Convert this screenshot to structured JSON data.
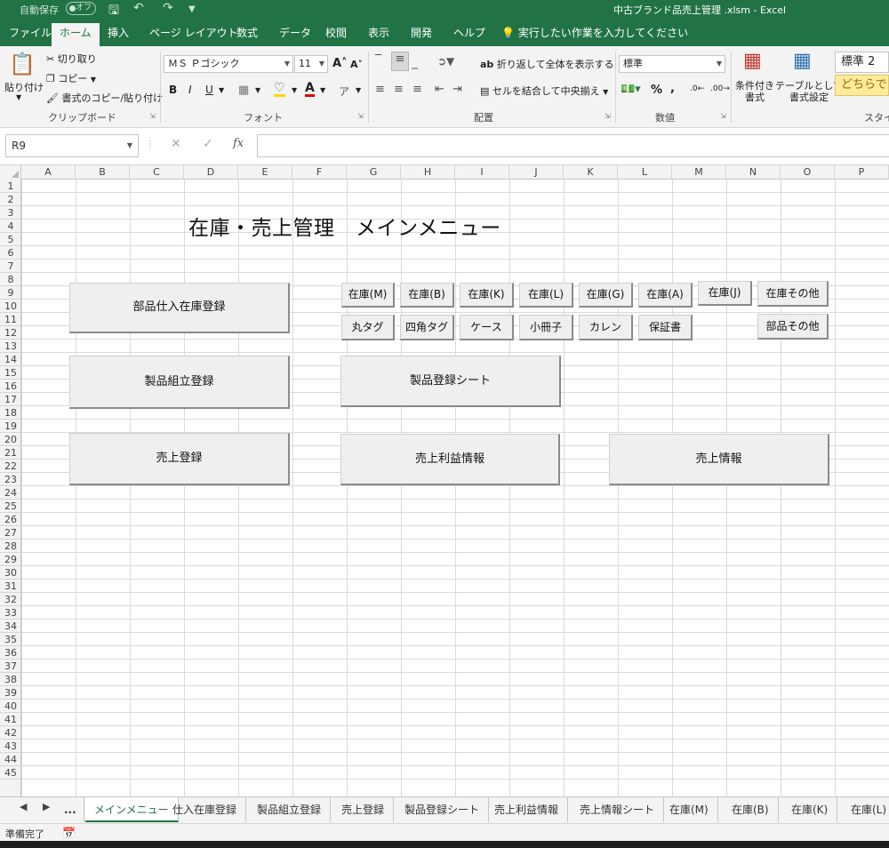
{
  "titlebar": {
    "autosave_label": "自動保存",
    "autosave_state": "オフ",
    "document_title": "中古ブランド品売上管理 .xlsm  -  Excel"
  },
  "ribbon_tabs": [
    "ファイル",
    "ホーム",
    "挿入",
    "ページ レイアウト",
    "数式",
    "データ",
    "校閲",
    "表示",
    "開発",
    "ヘルプ"
  ],
  "active_ribbon_tab": "ホーム",
  "tell_me": "実行したい作業を入力してください",
  "clipboard": {
    "paste": "貼り付け",
    "cut": "切り取り",
    "copy": "コピー",
    "format_painter": "書式のコピー/貼り付け",
    "group_label": "クリップボード"
  },
  "font": {
    "font_name": "ＭＳ Ｐゴシック",
    "font_size": "11",
    "group_label": "フォント"
  },
  "alignment": {
    "wrap_text": "折り返して全体を表示する",
    "merge_center": "セルを結合して中央揃え",
    "group_label": "配置"
  },
  "number": {
    "format": "標準",
    "group_label": "数値"
  },
  "styles": {
    "conditional": "条件付き\n書式",
    "table": "テーブルとして\n書式設定",
    "style_normal": "標準 2",
    "style_neutral": "どちらでも",
    "group_label": "スタイル"
  },
  "formula_bar": {
    "name_box": "R9",
    "formula": ""
  },
  "columns": [
    "A",
    "B",
    "C",
    "D",
    "E",
    "F",
    "G",
    "H",
    "I",
    "J",
    "K",
    "L",
    "M",
    "N",
    "O",
    "P"
  ],
  "rows": [
    "1",
    "2",
    "3",
    "4",
    "5",
    "6",
    "7",
    "8",
    "9",
    "10",
    "11",
    "12",
    "13",
    "14",
    "15",
    "16",
    "17",
    "18",
    "19",
    "20",
    "21",
    "22",
    "23",
    "24",
    "25",
    "26",
    "27",
    "28",
    "29",
    "30",
    "31",
    "32",
    "33",
    "34",
    "35",
    "36",
    "37",
    "38",
    "39",
    "40",
    "41",
    "42",
    "43",
    "44",
    "45"
  ],
  "sheet": {
    "title": "在庫・売上管理　メインメニュー",
    "main_buttons": {
      "parts_purchase": "部品仕入在庫登録",
      "product_assembly": "製品組立登録",
      "sales_entry": "売上登録",
      "product_sheet": "製品登録シート",
      "sales_profit": "売上利益情報",
      "sales_info": "売上情報"
    },
    "stock_buttons": [
      "在庫(M)",
      "在庫(B)",
      "在庫(K)",
      "在庫(L)",
      "在庫(G)",
      "在庫(A)",
      "在庫(J)",
      "在庫その他"
    ],
    "part_buttons": [
      "丸タグ",
      "四角タグ",
      "ケース",
      "小冊子",
      "カレン",
      "保証書",
      "部品その他"
    ]
  },
  "sheet_tabs": {
    "ellipsis": "...",
    "tabs": [
      "メインメニュー",
      "仕入在庫登録",
      "製品組立登録",
      "売上登録",
      "製品登録シート",
      "売上利益情報",
      "売上情報シート",
      "在庫(M)",
      "在庫(B)",
      "在庫(K)",
      "在庫(L)"
    ],
    "active": "メインメニュー"
  },
  "status": {
    "ready": "準備完了"
  },
  "colors": {
    "excel_green": "#217346",
    "ribbon_bg": "#f3f3f3",
    "neutral_style": "#ffeb9c"
  }
}
